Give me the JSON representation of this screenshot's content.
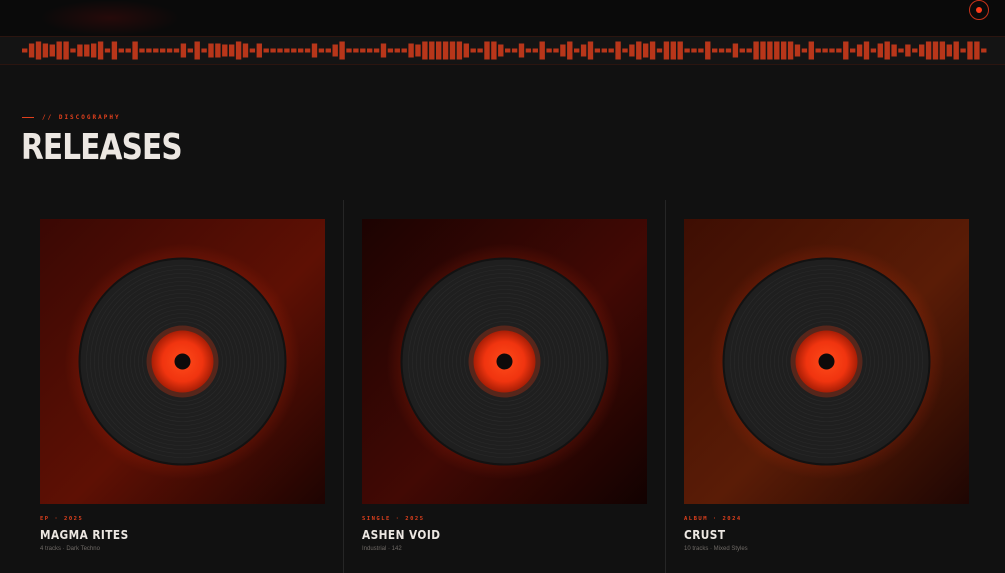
{
  "header": {
    "rec_button_icon": "record-dot-icon",
    "accent": "#ff3b1a"
  },
  "waveform": {
    "color": "#b8361a",
    "levels": [
      0.2,
      0.7,
      0.9,
      0.7,
      0.6,
      0.9,
      0.9,
      0.2,
      0.6,
      0.6,
      0.7,
      0.9,
      0.2,
      0.9,
      0.2,
      0.2,
      0.9,
      0.2,
      0.2,
      0.2,
      0.2,
      0.2,
      0.2,
      0.7,
      0.2,
      0.9,
      0.2,
      0.7,
      0.7,
      0.6,
      0.6,
      0.9,
      0.7,
      0.2,
      0.7,
      0.2,
      0.2,
      0.2,
      0.2,
      0.2,
      0.2,
      0.2,
      0.7,
      0.2,
      0.2,
      0.6,
      0.9,
      0.2,
      0.2,
      0.2,
      0.2,
      0.2,
      0.7,
      0.2,
      0.2,
      0.2,
      0.7,
      0.6,
      0.9,
      0.9,
      0.9,
      0.9,
      0.9,
      0.9,
      0.7,
      0.2,
      0.2,
      0.9,
      0.9,
      0.6,
      0.2,
      0.2,
      0.7,
      0.2,
      0.2,
      0.9,
      0.2,
      0.2,
      0.6,
      0.9,
      0.2,
      0.6,
      0.9,
      0.2,
      0.2,
      0.2,
      0.9,
      0.2,
      0.6,
      0.9,
      0.7,
      0.9,
      0.2,
      0.9,
      0.9,
      0.9,
      0.2,
      0.2,
      0.2,
      0.9,
      0.2,
      0.2,
      0.2,
      0.7,
      0.2,
      0.2,
      0.9,
      0.9,
      0.9,
      0.9,
      0.9,
      0.9,
      0.6,
      0.2,
      0.9,
      0.2,
      0.2,
      0.2,
      0.2,
      0.9,
      0.2,
      0.6,
      0.9,
      0.2,
      0.7,
      0.9,
      0.6,
      0.2,
      0.6,
      0.2,
      0.6,
      0.9,
      0.9,
      0.9,
      0.6,
      0.9,
      0.2,
      0.9,
      0.9,
      0.2
    ]
  },
  "section": {
    "kicker": "// DISCOGRAPHY",
    "title": "RELEASES"
  },
  "releases": [
    {
      "meta": "EP · 2025",
      "title": "MAGMA RITES",
      "subtitle": "4 tracks · Dark Techno",
      "cover_colors": [
        "#3a0804",
        "#5e1004",
        "#1e0402"
      ]
    },
    {
      "meta": "SINGLE · 2025",
      "title": "ASHEN VOID",
      "subtitle": "Industrial · 142",
      "cover_colors": [
        "#1c0302",
        "#420904",
        "#120201"
      ]
    },
    {
      "meta": "ALBUM · 2024",
      "title": "CRUST",
      "subtitle": "10 tracks · Mixed Styles",
      "cover_colors": [
        "#3e0e03",
        "#5a1c06",
        "#1e0603"
      ]
    }
  ]
}
